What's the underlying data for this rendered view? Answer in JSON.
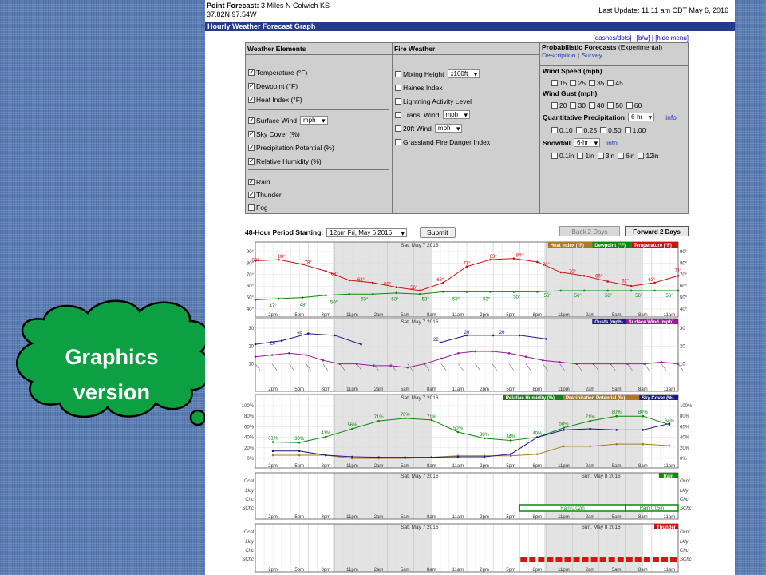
{
  "header": {
    "point_forecast_label": "Point Forecast:",
    "location": "3 Miles N Colwich KS",
    "coords": "37.82N 97.54W",
    "last_update": "Last Update: 11:11 am CDT May 6, 2016",
    "title": "Hourly Weather Forecast Graph"
  },
  "top_links": [
    "[dashes/dots]",
    "[b/w]",
    "[hide menu]"
  ],
  "menu": {
    "col1_title": "Weather Elements",
    "col2_title": "Fire Weather",
    "col3_title": "Probabilistic Forecasts",
    "col3_sub": "(Experimental)",
    "col3_desc": "Description",
    "col3_survey": "Survey",
    "weather": {
      "temperature": "Temperature (°F)",
      "dewpoint": "Dewpoint (°F)",
      "heat_index": "Heat Index (°F)",
      "surface_wind": "Surface Wind",
      "surface_wind_unit": "mph",
      "sky_cover": "Sky Cover (%)",
      "precip": "Precipitation Potential (%)",
      "rh": "Relative Humidity (%)",
      "rain": "Rain",
      "thunder": "Thunder",
      "fog": "Fog"
    },
    "fire": {
      "mixing": "Mixing Height",
      "mixing_unit": "x100ft",
      "haines": "Haines Index",
      "lightning": "Lightning Activity Level",
      "trans": "Trans. Wind",
      "trans_unit": "mph",
      "wind20": "20ft Wind",
      "wind20_unit": "mph",
      "grassland": "Grassland Fire Danger Index"
    },
    "prob": {
      "wind_speed": "Wind Speed (mph)",
      "ws": [
        "15",
        "25",
        "35",
        "45"
      ],
      "wind_gust": "Wind Gust (mph)",
      "wg": [
        "20",
        "30",
        "40",
        "50",
        "60"
      ],
      "qpf": "Quantitative Precipitation",
      "qpf_period": "6-hr",
      "qpf_info": "info",
      "qp": [
        "0.10",
        "0.25",
        "0.50",
        "1.00"
      ],
      "snow": "Snowfall",
      "snow_period": "6-hr",
      "snow_info": "info",
      "sn": [
        "0.1in",
        "1in",
        "3in",
        "6in",
        "12in"
      ]
    }
  },
  "period": {
    "label": "48-Hour Period Starting:",
    "value": "12pm Fri, May 6 2016",
    "submit": "Submit",
    "back": "Back 2 Days",
    "forward": "Forward 2 Days"
  },
  "graphs": {
    "hours": [
      "2pm",
      "5pm",
      "8pm",
      "11pm",
      "2am",
      "5am",
      "8am",
      "11am",
      "2pm",
      "5pm",
      "8pm",
      "11pm",
      "2am",
      "5am",
      "8am",
      "11am"
    ],
    "day1": "Sat, May 7 2016",
    "day2": "Sun, May 8 2016",
    "temp_panel": {
      "legend": [
        {
          "name": "Heat Index (°F)",
          "color": "#b07820"
        },
        {
          "name": "Dewpoint (°F)",
          "color": "#0a8a0a"
        },
        {
          "name": "Temperature (°F)",
          "color": "#cc1111"
        }
      ],
      "yticks": [
        "90°",
        "80°",
        "70°",
        "60°",
        "50°",
        "40°"
      ],
      "temperature": [
        82,
        83,
        79,
        73,
        65,
        63,
        59,
        56,
        63,
        77,
        83,
        84,
        81,
        72,
        69,
        64,
        60,
        63,
        69
      ],
      "dewpoint": [
        48,
        49,
        50,
        52,
        53,
        53,
        54,
        53,
        55,
        55,
        55,
        55,
        55,
        56,
        56,
        56,
        56,
        56,
        56
      ],
      "temperature_labels": [
        "80°",
        "83°",
        "78°",
        "68°",
        "63°",
        "59°",
        "56°",
        "63°",
        "77°",
        "83°",
        "84°",
        "76°",
        "70°",
        "66°",
        "62°",
        "63°",
        "71°"
      ],
      "dewpoint_labels": [
        "47°",
        "48°",
        "50°",
        "53°",
        "53°",
        "53°",
        "53°",
        "53°",
        "55°",
        "56°",
        "56°",
        "56°",
        "56°",
        "56°"
      ]
    },
    "wind_panel": {
      "legend": [
        {
          "name": "Gusts (mph)",
          "color": "#1a1a8a"
        },
        {
          "name": "Surface Wind (mph)",
          "color": "#9a1a9a"
        }
      ],
      "yticks": [
        "30",
        "20",
        "10"
      ],
      "surface_wind": [
        14,
        15,
        16,
        15,
        12,
        10,
        10,
        9,
        9,
        8,
        10,
        13,
        16,
        17,
        17,
        16,
        14,
        12,
        11,
        10,
        10,
        10,
        10,
        10,
        11,
        10
      ],
      "gusts": [
        21,
        23,
        27,
        26,
        21
      ],
      "gusts2": [
        22,
        26,
        26,
        26,
        24
      ],
      "gust_labels": [
        "20",
        "25",
        "22",
        "26",
        "26"
      ],
      "wind_labels": [
        "12",
        "7",
        "8",
        "10"
      ]
    },
    "pct_panel": {
      "legend": [
        {
          "name": "Relative Humidity (%)",
          "color": "#0a8a0a"
        },
        {
          "name": "Precipitation Potential (%)",
          "color": "#b07820"
        },
        {
          "name": "Sky Cover (%)",
          "color": "#1a1a8a"
        }
      ],
      "yticks": [
        "100%",
        "80%",
        "60%",
        "40%",
        "20%",
        "0%"
      ],
      "rh": [
        31,
        30,
        41,
        56,
        71,
        76,
        73,
        50,
        38,
        34,
        40,
        58,
        71,
        80,
        80,
        64
      ],
      "precip": [
        6,
        6,
        6,
        0,
        0,
        0,
        2,
        5,
        5,
        5,
        8,
        23,
        23,
        27,
        27,
        24
      ],
      "sky": [
        14,
        14,
        6,
        3,
        2,
        2,
        2,
        3,
        3,
        8,
        40,
        54,
        56,
        54,
        54,
        66
      ],
      "rh_labels": [
        "31%",
        "30%",
        "41%",
        "56%",
        "71%",
        "76%",
        "71%",
        "50%",
        "38%",
        "34%",
        "40%",
        "58%",
        "71%",
        "80%",
        "80%",
        "64%"
      ],
      "precip_labels": [
        "6%",
        "6%",
        "0%",
        "0%",
        "0%",
        "23%",
        "23%",
        "27%",
        "27%"
      ],
      "sky_labels": [
        "14%",
        "14%",
        "6%",
        "2%",
        "2%",
        "8%",
        "61%",
        "56%",
        "54%",
        "65%"
      ]
    },
    "rain_panel": {
      "legend": "Rain",
      "yticks": [
        "Ocnl",
        "Lkly",
        "Chc",
        "SChc"
      ],
      "bar1": "Rain 0.02in",
      "bar2": "Rain 0.05in"
    },
    "thunder_panel": {
      "legend": "Thunder",
      "yticks": [
        "Ocnl",
        "Lkly",
        "Chc",
        "SChc"
      ]
    }
  },
  "callout": {
    "line1": "Graphics",
    "line2": "version"
  }
}
